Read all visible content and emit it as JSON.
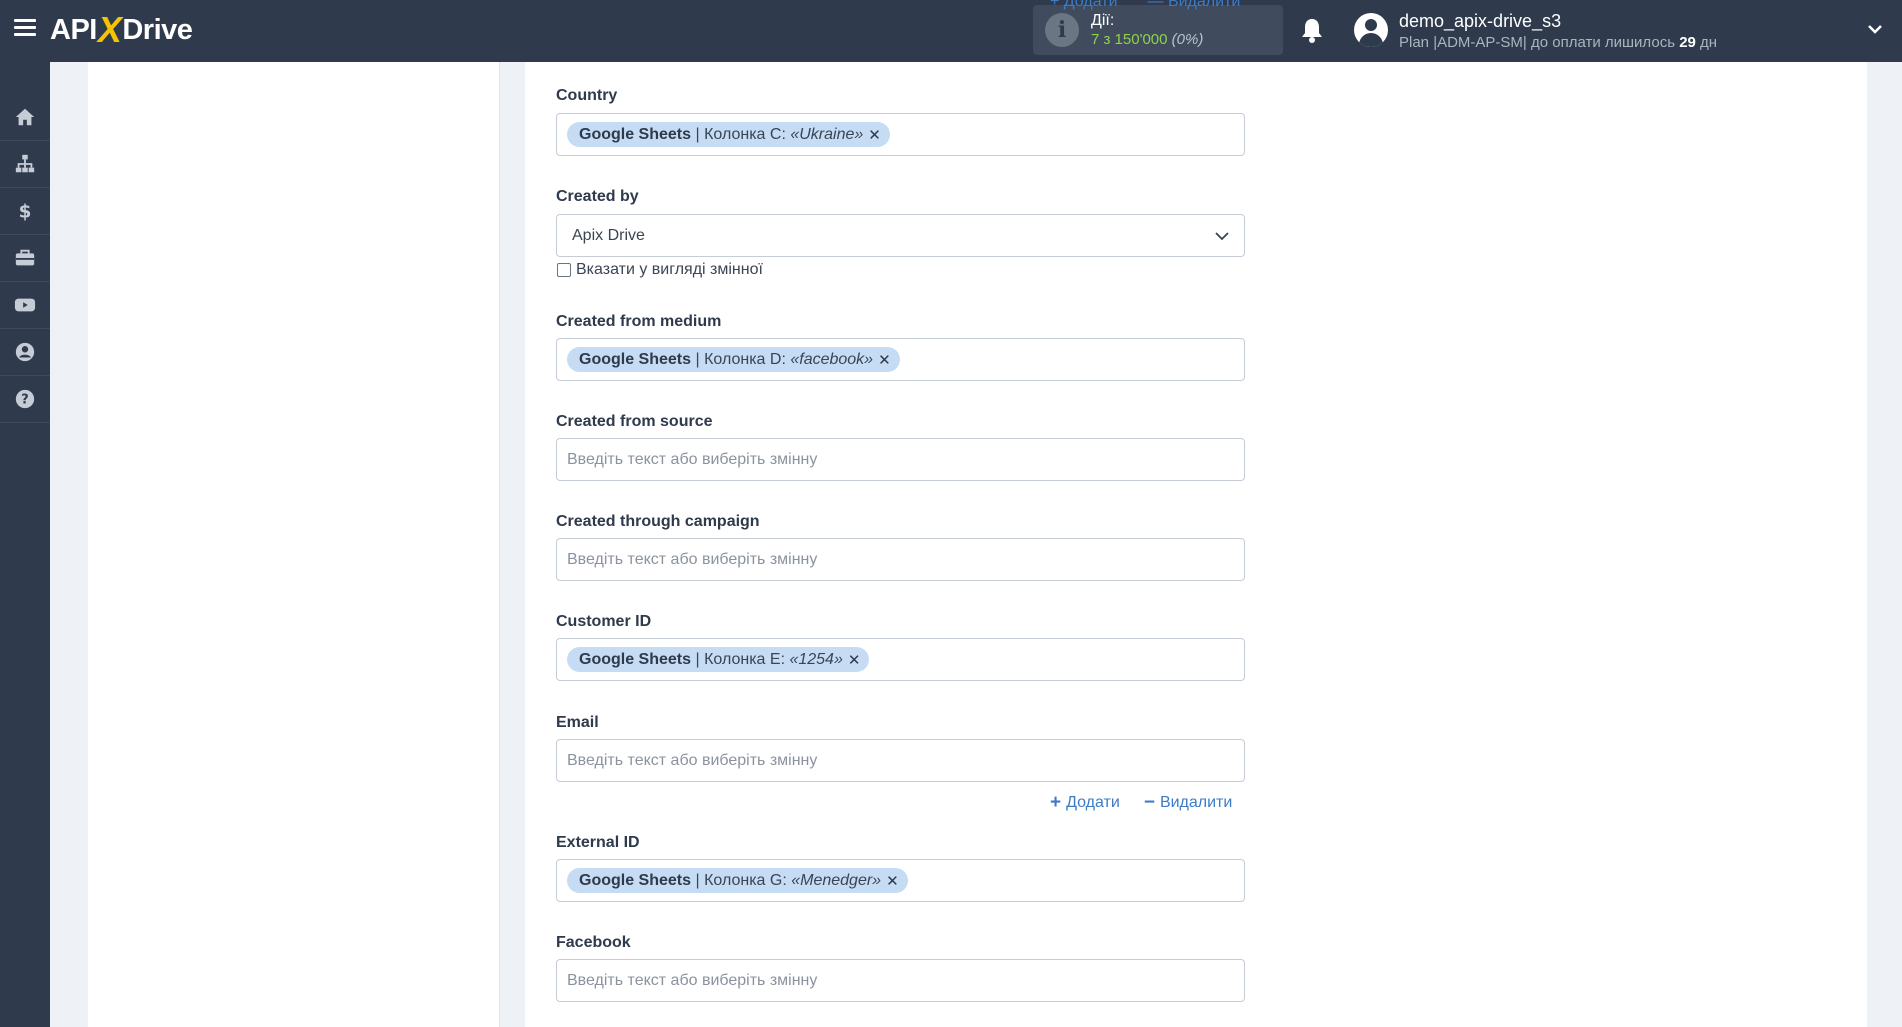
{
  "header": {
    "logo_left": "API",
    "logo_x": "X",
    "logo_right": "Drive",
    "actions_label": "Дії:",
    "actions_count": "7 з 150'000",
    "actions_percent": "(0%)",
    "user_name": "demo_apix-drive_s3",
    "plan_text": "Plan |ADM-AP-SM| до оплати лишилось",
    "days_left": "29",
    "days_unit": "дн"
  },
  "sidebar": {
    "items": [
      "home-icon",
      "sitemap-icon",
      "dollar-icon",
      "briefcase-icon",
      "youtube-icon",
      "user-circle-icon",
      "help-icon"
    ]
  },
  "top_partial_links": {
    "add": "+ Додати",
    "remove": "— Видалити"
  },
  "fields": {
    "country": {
      "label": "Country",
      "tag_source": "Google Sheets",
      "tag_column": " | Колонка C: ",
      "tag_value": "«Ukraine»"
    },
    "created_by": {
      "label": "Created by",
      "selected": "Apix Drive",
      "checkbox_label": "Вказати у вигляді змінної"
    },
    "created_from_medium": {
      "label": "Created from medium",
      "tag_source": "Google Sheets",
      "tag_column": " | Колонка D: ",
      "tag_value": "«facebook»"
    },
    "created_from_source": {
      "label": "Created from source",
      "placeholder": "Введіть текст або виберіть змінну"
    },
    "created_through_campaign": {
      "label": "Created through campaign",
      "placeholder": "Введіть текст або виберіть змінну"
    },
    "customer_id": {
      "label": "Customer ID",
      "tag_source": "Google Sheets",
      "tag_column": " | Колонка E: ",
      "tag_value": "«1254»"
    },
    "email": {
      "label": "Email",
      "placeholder": "Введіть текст або виберіть змінну",
      "add_label": "Додати",
      "remove_label": "Видалити"
    },
    "external_id": {
      "label": "External ID",
      "tag_source": "Google Sheets",
      "tag_column": " | Колонка G: ",
      "tag_value": "«Menedger»"
    },
    "facebook": {
      "label": "Facebook",
      "placeholder": "Введіть текст або виберіть змінну"
    }
  },
  "colors": {
    "topbar": "#2f3b4c",
    "accent_link": "#3e7bc6",
    "tag_bg": "#c6dcf5",
    "logo_x": "#f5c400",
    "actions_count": "#8fd14f"
  }
}
